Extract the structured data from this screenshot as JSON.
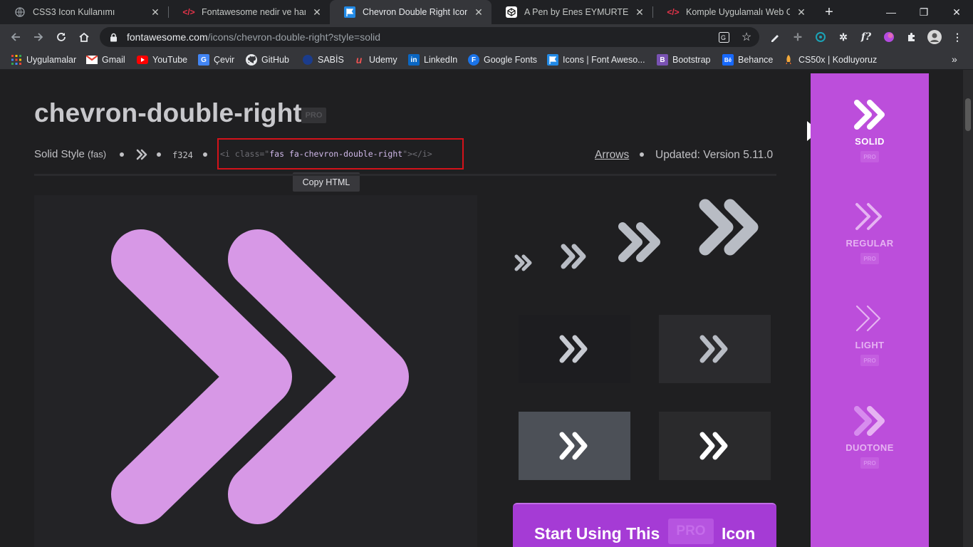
{
  "browser": {
    "tabs": [
      {
        "title": "CSS3 Icon Kullanımı",
        "icon": "globe-icon"
      },
      {
        "title": "Fontawesome nedir ve hangi a",
        "icon": "code-icon"
      },
      {
        "title": "Chevron Double Right Icon | Fo",
        "icon": "flag-icon",
        "active": true
      },
      {
        "title": "A Pen by Enes EYMURTEPE",
        "icon": "codepen-icon"
      },
      {
        "title": "Komple Uygulamalı Web Geliş",
        "icon": "code-icon"
      }
    ],
    "new_tab_label": "+",
    "url_host": "fontawesome.com",
    "url_path": "/icons/chevron-double-right?style=solid",
    "bookmarks": [
      {
        "label": "Uygulamalar",
        "icon": "apps-grid-icon"
      },
      {
        "label": "Gmail",
        "icon": "gmail-icon"
      },
      {
        "label": "YouTube",
        "icon": "youtube-icon"
      },
      {
        "label": "Çevir",
        "icon": "translate-icon"
      },
      {
        "label": "GitHub",
        "icon": "github-icon"
      },
      {
        "label": "SABİS",
        "icon": "sabis-icon"
      },
      {
        "label": "Udemy",
        "icon": "udemy-icon"
      },
      {
        "label": "LinkedIn",
        "icon": "linkedin-icon"
      },
      {
        "label": "Google Fonts",
        "icon": "google-fonts-icon"
      },
      {
        "label": "Icons | Font Aweso...",
        "icon": "flag-icon"
      },
      {
        "label": "Bootstrap",
        "icon": "bootstrap-icon"
      },
      {
        "label": "Behance",
        "icon": "behance-icon"
      },
      {
        "label": "CS50x | Kodluyoruz",
        "icon": "rocket-icon"
      }
    ],
    "bookmarks_more": "»"
  },
  "icon_page": {
    "title": "chevron-double-right",
    "pro_badge": "PRO",
    "style_label": "Solid Style",
    "style_prefix": "(fas)",
    "unicode": "f324",
    "snippet_open": "<i class=\"",
    "snippet_value": "fas fa-chevron-double-right",
    "snippet_close": "\"></i>",
    "copy_tooltip": "Copy HTML",
    "category": "Arrows",
    "updated": "Updated: Version 5.11.0",
    "cta_start": "Start Using This",
    "cta_pro": "PRO",
    "cta_end": "Icon"
  },
  "styles": [
    {
      "label": "SOLID",
      "pro": "PRO",
      "active": true
    },
    {
      "label": "REGULAR",
      "pro": "PRO"
    },
    {
      "label": "LIGHT",
      "pro": "PRO"
    },
    {
      "label": "DUOTONE",
      "pro": "PRO"
    }
  ],
  "colors": {
    "accent_purple": "#bc4edb",
    "preview_icon": "#d798e6",
    "cta_bg": "#a53bd5",
    "highlight_border": "#d4121a"
  }
}
